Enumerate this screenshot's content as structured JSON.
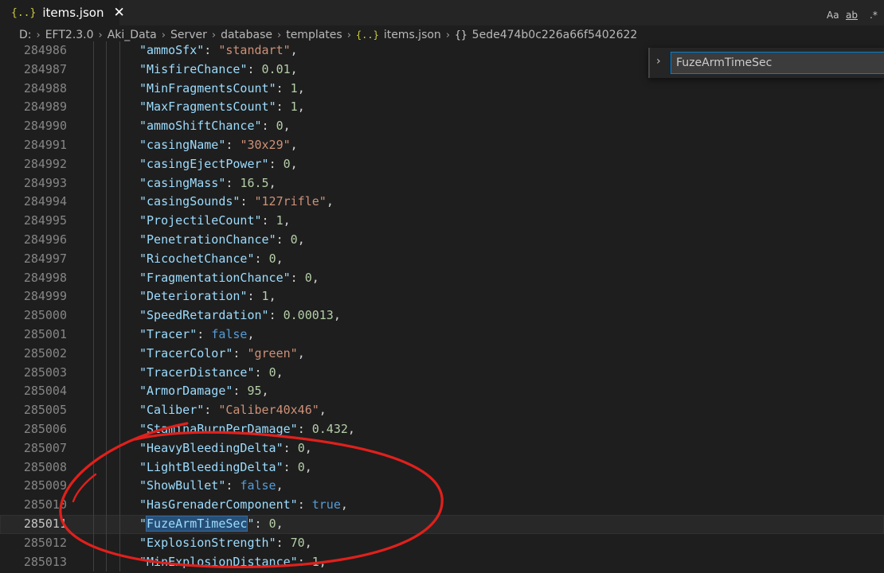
{
  "tab": {
    "icon": "{..}",
    "label": "items.json",
    "close": "✕"
  },
  "breadcrumb": {
    "items": [
      "D:",
      "EFT2.3.0",
      "Aki_Data",
      "Server",
      "database",
      "templates",
      "items.json",
      "5ede474b0c226a66f5402622"
    ],
    "json_icon": "{..}",
    "object_icon": "{}"
  },
  "find": {
    "query": "FuzeArmTimeSec",
    "match_case": "Aa",
    "whole_word": "ab",
    "regex": ".*"
  },
  "editor": {
    "current_line": "285011",
    "highlight_key": "FuzeArmTimeSec",
    "lines": [
      {
        "num": "284986",
        "key": "ammoSfx",
        "value": "\"standart\"",
        "type": "s"
      },
      {
        "num": "284987",
        "key": "MisfireChance",
        "value": "0.01",
        "type": "n"
      },
      {
        "num": "284988",
        "key": "MinFragmentsCount",
        "value": "1",
        "type": "n"
      },
      {
        "num": "284989",
        "key": "MaxFragmentsCount",
        "value": "1",
        "type": "n"
      },
      {
        "num": "284990",
        "key": "ammoShiftChance",
        "value": "0",
        "type": "n"
      },
      {
        "num": "284991",
        "key": "casingName",
        "value": "\"30x29\"",
        "type": "s"
      },
      {
        "num": "284992",
        "key": "casingEjectPower",
        "value": "0",
        "type": "n"
      },
      {
        "num": "284993",
        "key": "casingMass",
        "value": "16.5",
        "type": "n"
      },
      {
        "num": "284994",
        "key": "casingSounds",
        "value": "\"127rifle\"",
        "type": "s"
      },
      {
        "num": "284995",
        "key": "ProjectileCount",
        "value": "1",
        "type": "n"
      },
      {
        "num": "284996",
        "key": "PenetrationChance",
        "value": "0",
        "type": "n"
      },
      {
        "num": "284997",
        "key": "RicochetChance",
        "value": "0",
        "type": "n"
      },
      {
        "num": "284998",
        "key": "FragmentationChance",
        "value": "0",
        "type": "n"
      },
      {
        "num": "284999",
        "key": "Deterioration",
        "value": "1",
        "type": "n"
      },
      {
        "num": "285000",
        "key": "SpeedRetardation",
        "value": "0.00013",
        "type": "n"
      },
      {
        "num": "285001",
        "key": "Tracer",
        "value": "false",
        "type": "b"
      },
      {
        "num": "285002",
        "key": "TracerColor",
        "value": "\"green\"",
        "type": "s"
      },
      {
        "num": "285003",
        "key": "TracerDistance",
        "value": "0",
        "type": "n"
      },
      {
        "num": "285004",
        "key": "ArmorDamage",
        "value": "95",
        "type": "n"
      },
      {
        "num": "285005",
        "key": "Caliber",
        "value": "\"Caliber40x46\"",
        "type": "s"
      },
      {
        "num": "285006",
        "key": "StaminaBurnPerDamage",
        "value": "0.432",
        "type": "n"
      },
      {
        "num": "285007",
        "key": "HeavyBleedingDelta",
        "value": "0",
        "type": "n"
      },
      {
        "num": "285008",
        "key": "LightBleedingDelta",
        "value": "0",
        "type": "n"
      },
      {
        "num": "285009",
        "key": "ShowBullet",
        "value": "false",
        "type": "b"
      },
      {
        "num": "285010",
        "key": "HasGrenaderComponent",
        "value": "true",
        "type": "b"
      },
      {
        "num": "285011",
        "key": "FuzeArmTimeSec",
        "value": "0",
        "type": "n"
      },
      {
        "num": "285012",
        "key": "ExplosionStrength",
        "value": "70",
        "type": "n"
      },
      {
        "num": "285013",
        "key": "MinExplosionDistance",
        "value": "1",
        "type": "n"
      }
    ]
  },
  "colors": {
    "key": "#9cdcfe",
    "number": "#b5cea8",
    "string": "#ce9178",
    "boolean": "#569cd6",
    "annotation": "#e0201c",
    "find_border": "#007fd4"
  },
  "icons": {
    "tab_icon": "json-file-icon",
    "close": "close-icon",
    "breadcrumb_sep": "chevron-right-icon",
    "find_toggle": "chevron-right-icon"
  }
}
